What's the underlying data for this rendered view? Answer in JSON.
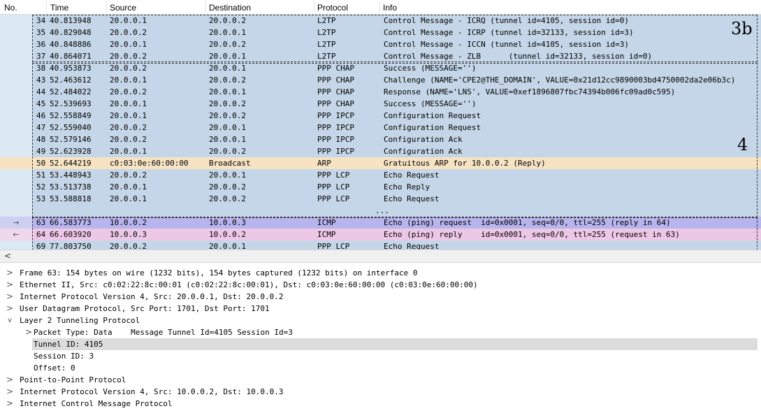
{
  "columns": {
    "no": "No.",
    "time": "Time",
    "source": "Source",
    "destination": "Destination",
    "protocol": "Protocol",
    "info": "Info"
  },
  "packets": [
    {
      "gutter": "",
      "no": "34",
      "time": "40.813948",
      "source": "20.0.0.1",
      "destination": "20.0.0.2",
      "protocol": "L2TP",
      "info": "Control Message - ICRQ (tunnel id=4105, session id=0)"
    },
    {
      "gutter": "",
      "no": "35",
      "time": "40.829048",
      "source": "20.0.0.2",
      "destination": "20.0.0.1",
      "protocol": "L2TP",
      "info": "Control Message - ICRP (tunnel id=32133, session id=3)"
    },
    {
      "gutter": "",
      "no": "36",
      "time": "40.848886",
      "source": "20.0.0.1",
      "destination": "20.0.0.2",
      "protocol": "L2TP",
      "info": "Control Message - ICCN (tunnel id=4105, session id=3)"
    },
    {
      "gutter": "",
      "no": "37",
      "time": "40.864071",
      "source": "20.0.0.2",
      "destination": "20.0.0.1",
      "protocol": "L2TP",
      "info": "Control Message - ZLB      (tunnel id=32133, session id=0)"
    },
    {
      "gutter": "",
      "no": "38",
      "time": "40.953873",
      "source": "20.0.0.2",
      "destination": "20.0.0.1",
      "protocol": "PPP CHAP",
      "info": "Success (MESSAGE='')"
    },
    {
      "gutter": "",
      "no": "43",
      "time": "52.463612",
      "source": "20.0.0.1",
      "destination": "20.0.0.2",
      "protocol": "PPP CHAP",
      "info": "Challenge (NAME='CPE2@THE_DOMAIN', VALUE=0x21d12cc9890003bd4750002da2e06b3c)"
    },
    {
      "gutter": "",
      "no": "44",
      "time": "52.484022",
      "source": "20.0.0.2",
      "destination": "20.0.0.1",
      "protocol": "PPP CHAP",
      "info": "Response (NAME='LNS', VALUE=0xef1896807fbc74394b006fc09ad0c595)"
    },
    {
      "gutter": "",
      "no": "45",
      "time": "52.539693",
      "source": "20.0.0.1",
      "destination": "20.0.0.2",
      "protocol": "PPP CHAP",
      "info": "Success (MESSAGE='')"
    },
    {
      "gutter": "",
      "no": "46",
      "time": "52.558849",
      "source": "20.0.0.1",
      "destination": "20.0.0.2",
      "protocol": "PPP IPCP",
      "info": "Configuration Request"
    },
    {
      "gutter": "",
      "no": "47",
      "time": "52.559040",
      "source": "20.0.0.2",
      "destination": "20.0.0.1",
      "protocol": "PPP IPCP",
      "info": "Configuration Request"
    },
    {
      "gutter": "",
      "no": "48",
      "time": "52.579146",
      "source": "20.0.0.2",
      "destination": "20.0.0.1",
      "protocol": "PPP IPCP",
      "info": "Configuration Ack"
    },
    {
      "gutter": "",
      "no": "49",
      "time": "52.623928",
      "source": "20.0.0.1",
      "destination": "20.0.0.2",
      "protocol": "PPP IPCP",
      "info": "Configuration Ack"
    },
    {
      "gutter": "",
      "no": "50",
      "time": "52.644219",
      "source": "c0:03:0e:60:00:00",
      "destination": "Broadcast",
      "protocol": "ARP",
      "info": "Gratuitous ARP for 10.0.0.2 (Reply)"
    },
    {
      "gutter": "",
      "no": "51",
      "time": "53.448943",
      "source": "20.0.0.2",
      "destination": "20.0.0.1",
      "protocol": "PPP LCP",
      "info": "Echo Request"
    },
    {
      "gutter": "",
      "no": "52",
      "time": "53.513738",
      "source": "20.0.0.1",
      "destination": "20.0.0.2",
      "protocol": "PPP LCP",
      "info": "Echo Reply"
    },
    {
      "gutter": "",
      "no": "53",
      "time": "53.588818",
      "source": "20.0.0.1",
      "destination": "20.0.0.2",
      "protocol": "PPP LCP",
      "info": "Echo Request"
    },
    {
      "gutter": "",
      "no": "",
      "time": "",
      "source": "",
      "destination": "",
      "protocol": "",
      "info": "..."
    },
    {
      "gutter": "→",
      "no": "63",
      "time": "66.583773",
      "source": "10.0.0.2",
      "destination": "10.0.0.3",
      "protocol": "ICMP",
      "info": "Echo (ping) request  id=0x0001, seq=0/0, ttl=255 (reply in 64)"
    },
    {
      "gutter": "←",
      "no": "64",
      "time": "66.603920",
      "source": "10.0.0.3",
      "destination": "10.0.0.2",
      "protocol": "ICMP",
      "info": "Echo (ping) reply    id=0x0001, seq=0/0, ttl=255 (request in 63)"
    },
    {
      "gutter": "",
      "no": "69",
      "time": "77.803750",
      "source": "20.0.0.2",
      "destination": "20.0.0.1",
      "protocol": "PPP LCP",
      "info": "Echo Request"
    }
  ],
  "annotations": {
    "label_3b": "3b",
    "label_4": "4"
  },
  "scrollbar": {
    "left_arrow": "<"
  },
  "details": [
    {
      "twisty": ">",
      "indent": 0,
      "text": "Frame 63: 154 bytes on wire (1232 bits), 154 bytes captured (1232 bits) on interface 0"
    },
    {
      "twisty": ">",
      "indent": 0,
      "text": "Ethernet II, Src: c0:02:22:8c:00:01 (c0:02:22:8c:00:01), Dst: c0:03:0e:60:00:00 (c0:03:0e:60:00:00)"
    },
    {
      "twisty": ">",
      "indent": 0,
      "text": "Internet Protocol Version 4, Src: 20.0.0.1, Dst: 20.0.0.2"
    },
    {
      "twisty": ">",
      "indent": 0,
      "text": "User Datagram Protocol, Src Port: 1701, Dst Port: 1701"
    },
    {
      "twisty": "v",
      "indent": 0,
      "text": "Layer 2 Tunneling Protocol"
    },
    {
      "twisty": ">",
      "indent": 1,
      "text": "Packet Type: Data    Message Tunnel Id=4105 Session Id=3"
    },
    {
      "twisty": "",
      "indent": 1,
      "text": "Tunnel ID: 4105"
    },
    {
      "twisty": "",
      "indent": 1,
      "text": "Session ID: 3"
    },
    {
      "twisty": "",
      "indent": 1,
      "text": "Offset: 0"
    },
    {
      "twisty": ">",
      "indent": 0,
      "text": "Point-to-Point Protocol"
    },
    {
      "twisty": ">",
      "indent": 0,
      "text": "Internet Protocol Version 4, Src: 10.0.0.2, Dst: 10.0.0.3"
    },
    {
      "twisty": ">",
      "indent": 0,
      "text": "Internet Control Message Protocol"
    }
  ],
  "colors": {
    "blue_row": "#c5d6e8",
    "arp_row": "#f7e3c2",
    "icmp_request_row": "#b8b4ee",
    "icmp_reply_row": "#ecc8e6",
    "selected_detail": "#dcdcdc"
  }
}
